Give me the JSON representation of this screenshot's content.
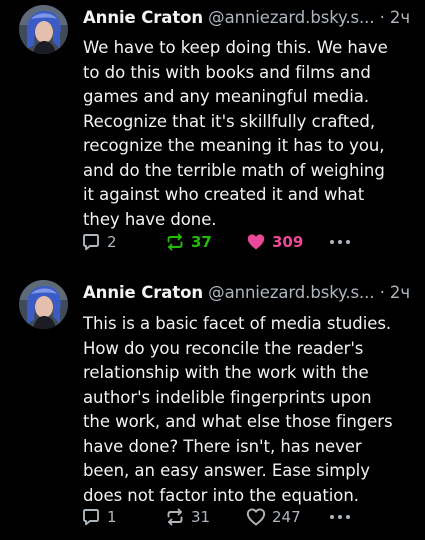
{
  "colors": {
    "background": "#000000",
    "text": "#f1f3f5",
    "muted": "#aeb5bd",
    "repost_active": "#20bc07",
    "like_active": "#ec4899"
  },
  "posts": [
    {
      "author": "Annie Craton",
      "handle": "@anniezard.bsky.s...",
      "separator": "·",
      "time": "2ч",
      "text_lines": [
        "We have to keep doing this. We have",
        "to do this with books and films and",
        "games and any meaningful media.",
        "Recognize that it's skillfully crafted,",
        "recognize the meaning it has to you,",
        "and do the terrible math of weighing",
        "it against who created it and what",
        "they have done."
      ],
      "replies": "2",
      "reposts": "37",
      "likes": "309",
      "reposted": true,
      "liked": true,
      "icons": [
        "reply-icon",
        "repost-icon",
        "heart-filled-icon",
        "more-icon"
      ]
    },
    {
      "author": "Annie Craton",
      "handle": "@anniezard.bsky.s...",
      "separator": "·",
      "time": "2ч",
      "text_lines": [
        "This is a basic facet of media studies.",
        "How do you reconcile the reader's",
        "relationship with the work with the",
        "author's indelible fingerprints upon",
        "the work, and what else those fingers",
        "have done? There isn't, has never",
        "been, an easy answer. Ease simply",
        "does not factor into the equation."
      ],
      "replies": "1",
      "reposts": "31",
      "likes": "247",
      "reposted": false,
      "liked": false,
      "icons": [
        "reply-icon",
        "repost-icon",
        "heart-outline-icon",
        "more-icon"
      ]
    }
  ]
}
